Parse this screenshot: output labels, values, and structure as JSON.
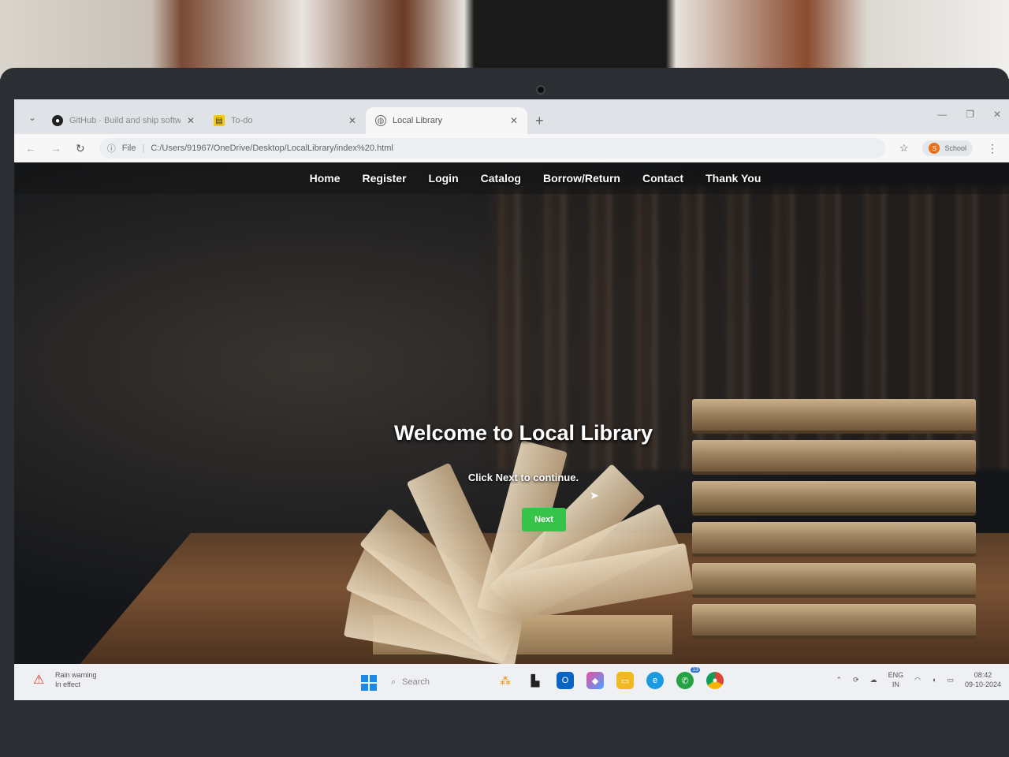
{
  "browser": {
    "tabs": [
      {
        "label": "GitHub · Build and ship softwa",
        "icon": "github-icon",
        "active": false
      },
      {
        "label": "To-do",
        "icon": "todo-icon",
        "active": false
      },
      {
        "label": "Local Library",
        "icon": "globe-icon",
        "active": true
      }
    ],
    "new_tab": "+",
    "address": {
      "scheme_label": "File",
      "url": "C:/Users/91967/OneDrive/Desktop/LocalLibrary/index%20.html"
    },
    "profile_label": "School",
    "profile_initial": "S"
  },
  "nav": {
    "items": [
      "Home",
      "Register",
      "Login",
      "Catalog",
      "Borrow/Return",
      "Contact",
      "Thank You"
    ]
  },
  "hero": {
    "title": "Welcome to Local Library",
    "subtitle": "Click Next to continue.",
    "button": "Next",
    "button_color": "#37c24a"
  },
  "taskbar": {
    "weather_title": "Rain warning",
    "weather_sub": "In effect",
    "search_placeholder": "Search",
    "lang_line1": "ENG",
    "lang_line2": "IN",
    "time": "08:42",
    "date": "09-10-2024",
    "whatsapp_badge": "13"
  }
}
